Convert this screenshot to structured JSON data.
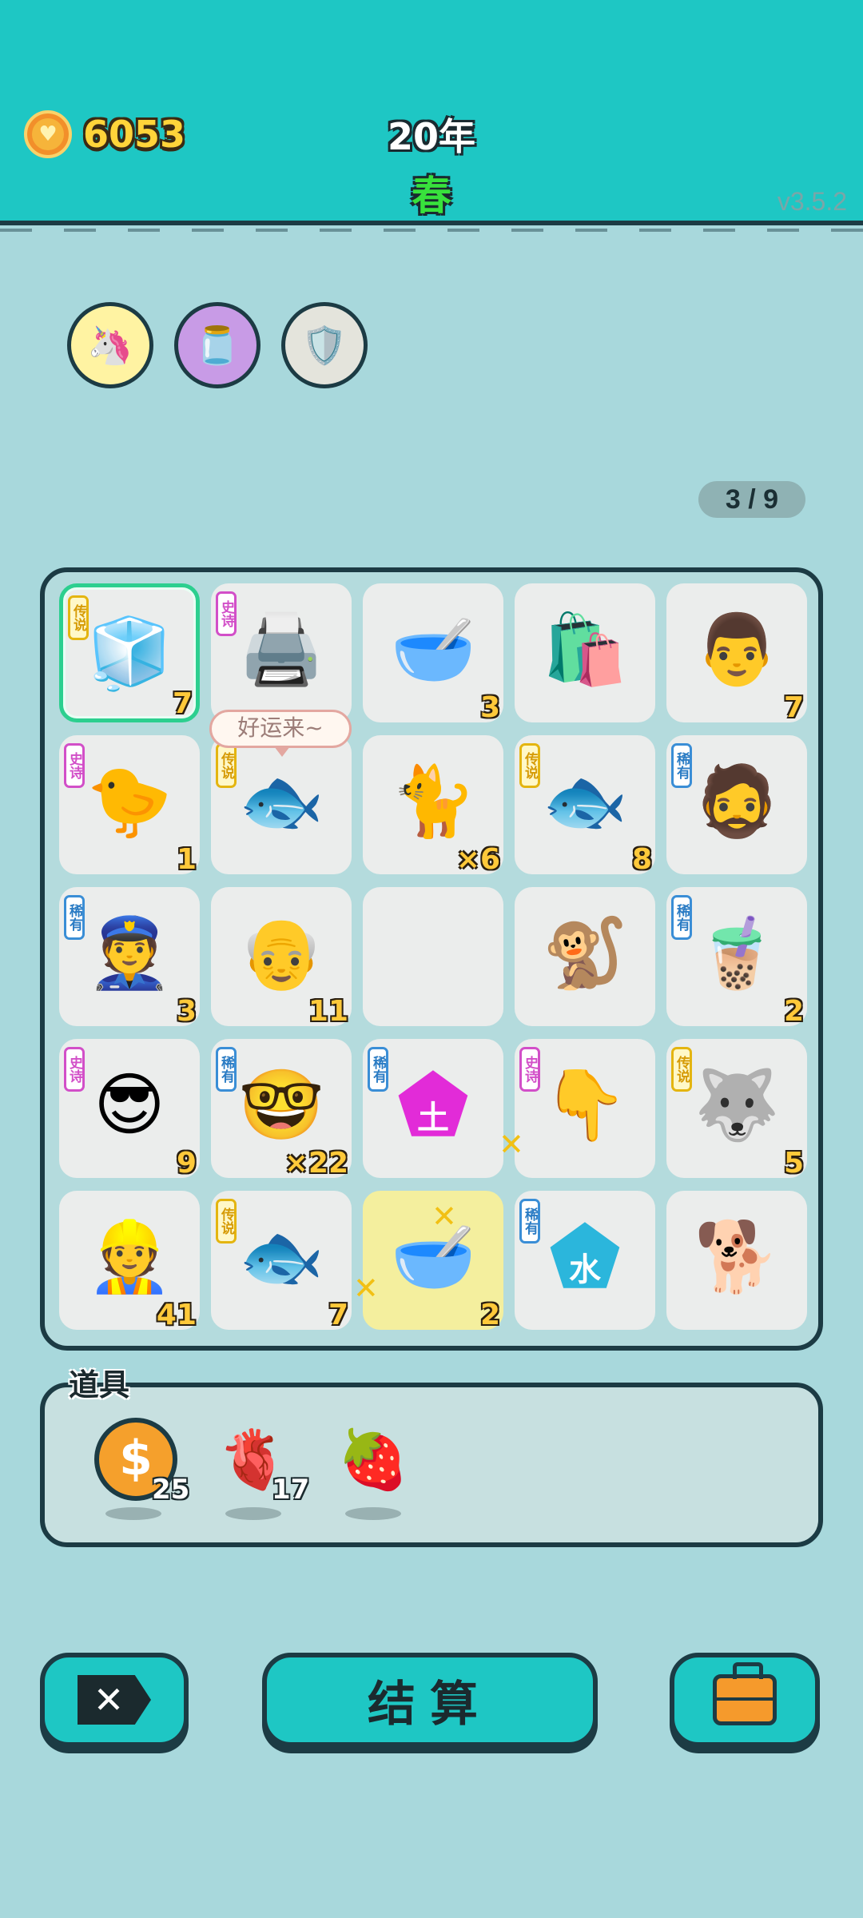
{
  "header": {
    "coins": "6053",
    "coin_icon": "heart-coin-icon",
    "year": "20年",
    "season": "春",
    "version": "v3.5.2"
  },
  "buffs": [
    {
      "icon": "unicorn-icon"
    },
    {
      "icon": "jar-icon"
    },
    {
      "icon": "wrench-shield-icon"
    }
  ],
  "progress": "3 / 9",
  "speech_bubble": "好运来~",
  "grid": [
    {
      "icon": "fridge-icon",
      "glyph": "🧊",
      "tag": "传说",
      "count": "7"
    },
    {
      "icon": "printer-icon",
      "glyph": "🖨️",
      "tag": "史诗",
      "count": ""
    },
    {
      "icon": "bowl-icon",
      "glyph": "🥣",
      "tag": "",
      "count": "3"
    },
    {
      "icon": "trash-bag-icon",
      "glyph": "🛍️",
      "tag": "",
      "count": ""
    },
    {
      "icon": "man-face-icon",
      "glyph": "👨",
      "tag": "",
      "count": "7"
    },
    {
      "icon": "chick-face-icon",
      "glyph": "🐤",
      "tag": "史诗",
      "count": "1"
    },
    {
      "icon": "koi-fish-icon",
      "glyph": "🐟",
      "tag": "传说",
      "count": ""
    },
    {
      "icon": "cat-icon",
      "glyph": "🐈",
      "tag": "",
      "count": "×6"
    },
    {
      "icon": "koi-fish-icon",
      "glyph": "🐟",
      "tag": "传说",
      "count": "8"
    },
    {
      "icon": "bucket-hat-man-icon",
      "glyph": "🧔",
      "tag": "稀有",
      "count": ""
    },
    {
      "icon": "police-man-icon",
      "glyph": "👮",
      "tag": "稀有",
      "count": "3"
    },
    {
      "icon": "cook-man-icon",
      "glyph": "👴",
      "tag": "",
      "count": "11"
    },
    {
      "icon": "empty-cell",
      "glyph": "",
      "tag": "",
      "count": ""
    },
    {
      "icon": "monkey-icon",
      "glyph": "🐒",
      "tag": "",
      "count": ""
    },
    {
      "icon": "bubble-tea-icon",
      "glyph": "🧋",
      "tag": "稀有",
      "count": "2"
    },
    {
      "icon": "green-hair-man-icon",
      "glyph": "😎",
      "tag": "史诗",
      "count": "9"
    },
    {
      "icon": "glasses-boy-icon",
      "glyph": "🤓",
      "tag": "稀有",
      "count": "×22"
    },
    {
      "icon": "earth-gem-icon",
      "glyph": "⬟",
      "tag": "稀有",
      "count": ""
    },
    {
      "icon": "pointing-hand-icon",
      "glyph": "👇",
      "tag": "史诗",
      "count": ""
    },
    {
      "icon": "king-husky-icon",
      "glyph": "🐺",
      "tag": "传说",
      "count": "5"
    },
    {
      "icon": "worker-man-icon",
      "glyph": "👷",
      "tag": "",
      "count": "41"
    },
    {
      "icon": "koi-fish-icon",
      "glyph": "🐟",
      "tag": "传说",
      "count": "7"
    },
    {
      "icon": "big-bowl-icon",
      "glyph": "🥣",
      "tag": "",
      "count": "2"
    },
    {
      "icon": "water-gem-icon",
      "glyph": "⬟",
      "tag": "稀有",
      "count": ""
    },
    {
      "icon": "brown-dog-icon",
      "glyph": "🐕",
      "tag": "",
      "count": ""
    }
  ],
  "gem_labels": {
    "earth": "土",
    "water": "水"
  },
  "items": {
    "title": "道具",
    "list": [
      {
        "icon": "dollar-coin-icon",
        "glyph": "$",
        "qty": "25"
      },
      {
        "icon": "liver-icon",
        "glyph": "🫀",
        "qty": "17"
      },
      {
        "icon": "bayberry-icon",
        "glyph": "🍓",
        "qty": ""
      }
    ]
  },
  "buttons": {
    "quit_icon": "close-x-icon",
    "settle_label": "结算",
    "bag_icon": "briefcase-icon"
  },
  "colors": {
    "header": "#1ec7c4",
    "background": "#a8d8dc",
    "epic": "#d24fc8",
    "legend": "#e4b510",
    "rare": "#3a8ed6"
  }
}
